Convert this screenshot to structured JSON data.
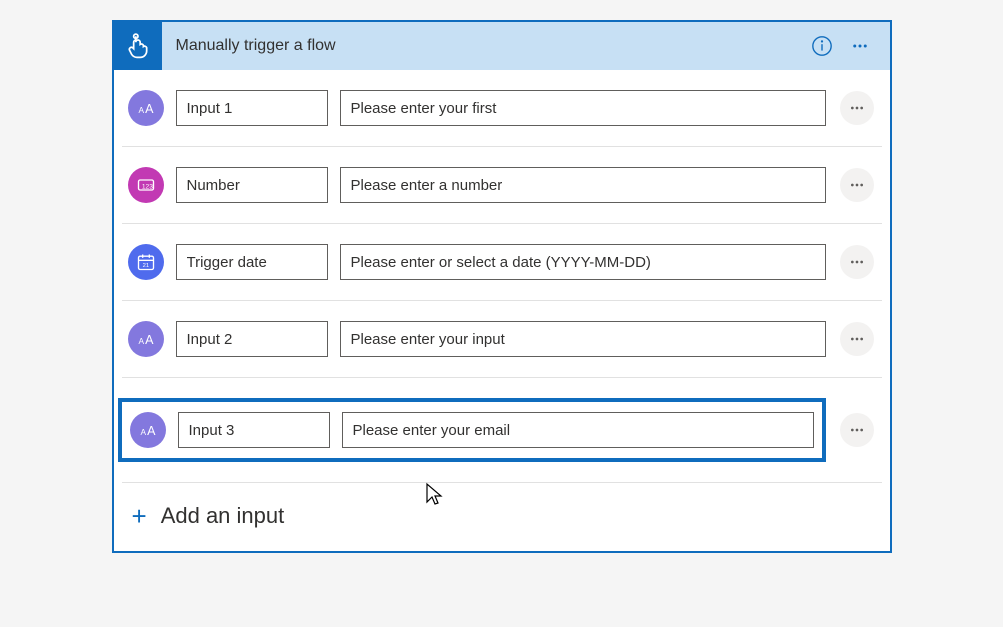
{
  "header": {
    "title": "Manually trigger a flow"
  },
  "inputs": [
    {
      "type": "text",
      "name": "Input 1",
      "placeholder": "Please enter your first",
      "highlighted": false
    },
    {
      "type": "number",
      "name": "Number",
      "placeholder": "Please enter a number",
      "highlighted": false
    },
    {
      "type": "date",
      "name": "Trigger date",
      "placeholder": "Please enter or select a date (YYYY-MM-DD)",
      "highlighted": false
    },
    {
      "type": "text",
      "name": "Input 2",
      "placeholder": "Please enter your input",
      "highlighted": false
    },
    {
      "type": "text",
      "name": "Input 3",
      "placeholder": "Please enter your email",
      "highlighted": true
    }
  ],
  "addInput": {
    "label": "Add an input"
  },
  "colors": {
    "accent": "#0f6cbd",
    "headerBg": "#c7e0f4",
    "textIcon": "#8378de",
    "numberIcon": "#c239b3",
    "dateIcon": "#4f6bed"
  }
}
